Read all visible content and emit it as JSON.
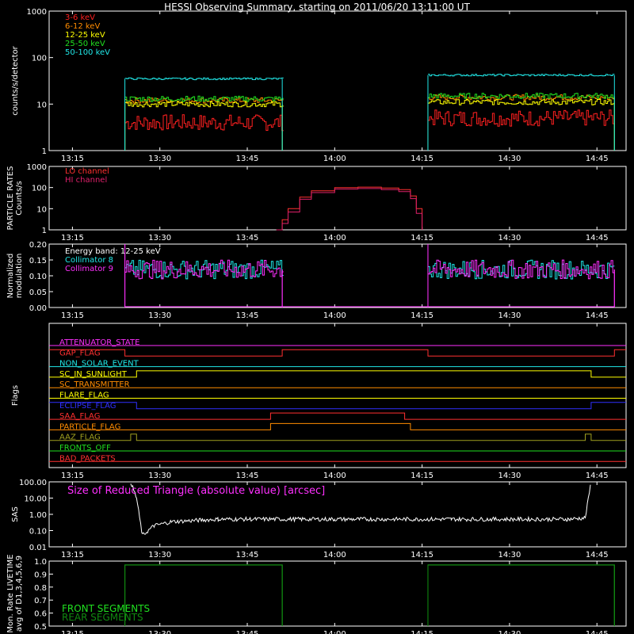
{
  "title": "HESSI Observing Summary, starting on 2011/06/20 13:11:00 UT",
  "time_ticks": [
    "13:15",
    "13:30",
    "13:45",
    "14:00",
    "14:15",
    "14:30",
    "14:45"
  ],
  "chart_data": [
    {
      "type": "line",
      "id": "count_rates",
      "ylabel": "counts/s/detector",
      "yscale": "log",
      "ylim": [
        1,
        1000
      ],
      "yticks": [
        "1",
        "10",
        "100",
        "1000"
      ],
      "x_unit": "UT",
      "series": [
        {
          "name": "3-6 keV",
          "color": "#ff2020",
          "segments": [
            {
              "start": "13:24",
              "end": "13:51",
              "level": 4
            },
            {
              "start": "14:16",
              "end": "14:48",
              "level": 5
            }
          ]
        },
        {
          "name": "6-12 keV",
          "color": "#ff8c00",
          "segments": [
            {
              "start": "13:24",
              "end": "13:51",
              "level": 12
            },
            {
              "start": "14:16",
              "end": "14:48",
              "level": 14
            }
          ]
        },
        {
          "name": "12-25 keV",
          "color": "#ffff00",
          "segments": [
            {
              "start": "13:24",
              "end": "13:51",
              "level": 10
            },
            {
              "start": "14:16",
              "end": "14:48",
              "level": 11
            }
          ]
        },
        {
          "name": "25-50 keV",
          "color": "#20e020",
          "segments": [
            {
              "start": "13:24",
              "end": "13:51",
              "level": 13
            },
            {
              "start": "14:16",
              "end": "14:48",
              "level": 15
            }
          ]
        },
        {
          "name": "50-100 keV",
          "color": "#20e8e8",
          "segments": [
            {
              "start": "13:24",
              "end": "13:51",
              "level": 35
            },
            {
              "start": "14:16",
              "end": "14:48",
              "level": 42
            }
          ]
        }
      ]
    },
    {
      "type": "line",
      "id": "particle_rates",
      "ylabel": "PARTICLE RATES Counts/s",
      "yscale": "log",
      "ylim": [
        1,
        1000
      ],
      "yticks": [
        "1",
        "10",
        "100",
        "1000"
      ],
      "series": [
        {
          "name": "LO channel",
          "color": "#ff3030",
          "points": [
            [
              "13:50",
              1
            ],
            [
              "13:51",
              3
            ],
            [
              "13:52",
              10
            ],
            [
              "13:54",
              35
            ],
            [
              "13:56",
              70
            ],
            [
              "14:00",
              100
            ],
            [
              "14:04",
              105
            ],
            [
              "14:08",
              95
            ],
            [
              "14:11",
              80
            ],
            [
              "14:13",
              40
            ],
            [
              "14:14",
              10
            ],
            [
              "14:15",
              1
            ]
          ]
        },
        {
          "name": "HI channel",
          "color": "#e0206a",
          "points": [
            [
              "13:50",
              1
            ],
            [
              "13:51",
              2
            ],
            [
              "13:52",
              7
            ],
            [
              "13:54",
              28
            ],
            [
              "13:56",
              58
            ],
            [
              "14:00",
              85
            ],
            [
              "14:04",
              90
            ],
            [
              "14:08",
              80
            ],
            [
              "14:11",
              65
            ],
            [
              "14:13",
              30
            ],
            [
              "14:14",
              6
            ],
            [
              "14:15",
              1
            ]
          ]
        }
      ]
    },
    {
      "type": "line",
      "id": "modulation",
      "ylabel": "Normalized modulation",
      "ylim": [
        0,
        0.2
      ],
      "yticks": [
        "0.00",
        "0.05",
        "0.10",
        "0.15",
        "0.20"
      ],
      "annotation": "Energy band: 12-25 keV",
      "series": [
        {
          "name": "Collimator 8",
          "color": "#20e8e8",
          "segments": [
            {
              "start": "13:24",
              "end": "13:51",
              "level": 0.12
            },
            {
              "start": "14:16",
              "end": "14:48",
              "level": 0.12
            }
          ]
        },
        {
          "name": "Collimator 9",
          "color": "#ff30ff",
          "segments": [
            {
              "start": "13:24",
              "end": "13:51",
              "level": 0.12
            },
            {
              "start": "14:16",
              "end": "14:48",
              "level": 0.12
            }
          ]
        }
      ]
    },
    {
      "type": "line",
      "id": "flags",
      "ylabel": "Flags",
      "series": [
        {
          "name": "ATTENUATOR_STATE",
          "color": "#ff30ff",
          "changes": []
        },
        {
          "name": "GAP_FLAG",
          "color": "#ff3030",
          "changes": [
            "13:24",
            "13:51",
            "14:16",
            "14:48"
          ],
          "initial": 1
        },
        {
          "name": "NON_SOLAR_EVENT",
          "color": "#20e8e8",
          "changes": []
        },
        {
          "name": "SC_IN_SUNLIGHT",
          "color": "#ffff00",
          "changes": [
            "13:26",
            "14:44"
          ],
          "initial": 0
        },
        {
          "name": "SC_TRANSMITTER",
          "color": "#ff8c00",
          "changes": []
        },
        {
          "name": "FLARE_FLAG",
          "color": "#ffff00",
          "changes": []
        },
        {
          "name": "ECLIPSE_FLAG",
          "color": "#3030ff",
          "changes": [
            "13:26",
            "14:44"
          ],
          "initial": 1
        },
        {
          "name": "SAA_FLAG",
          "color": "#ff3030",
          "changes": [
            "13:49",
            "14:12"
          ],
          "initial": 0
        },
        {
          "name": "PARTICLE_FLAG",
          "color": "#ff8c00",
          "changes": [
            "13:49",
            "14:13"
          ],
          "initial": 0
        },
        {
          "name": "AAZ_FLAG",
          "color": "#a0a020",
          "changes": [
            "13:25",
            "13:26",
            "14:43",
            "14:44"
          ],
          "initial": 0
        },
        {
          "name": "FRONTS_OFF",
          "color": "#20e020",
          "changes": []
        },
        {
          "name": "BAD_PACKETS",
          "color": "#ff3030",
          "changes": []
        }
      ]
    },
    {
      "type": "line",
      "id": "sas",
      "ylabel": "SAS",
      "yscale": "log",
      "ylim": [
        0.01,
        100
      ],
      "yticks": [
        "0.01",
        "0.10",
        "1.00",
        "10.00",
        "100.00"
      ],
      "annotation": "Size of Reduced Triangle (absolute value) [arcsec]",
      "series": [
        {
          "name": "SAS triangle",
          "color": "#ffffff",
          "points": [
            [
              "13:25",
              100
            ],
            [
              "13:26",
              10
            ],
            [
              "13:27",
              0.05
            ],
            [
              "13:29",
              0.2
            ],
            [
              "13:32",
              0.35
            ],
            [
              "13:40",
              0.5
            ],
            [
              "14:00",
              0.5
            ],
            [
              "14:20",
              0.5
            ],
            [
              "14:40",
              0.5
            ],
            [
              "14:43",
              0.6
            ],
            [
              "14:44",
              100
            ]
          ]
        }
      ]
    },
    {
      "type": "line",
      "id": "livetime",
      "ylabel": "Mon. Rate LIVETIME avg of D1,3,4,5,6,9",
      "ylim": [
        0.5,
        1.0
      ],
      "yticks": [
        "0.5",
        "0.6",
        "0.7",
        "0.8",
        "0.9",
        "1.0"
      ],
      "series": [
        {
          "name": "FRONT SEGMENTS",
          "color": "#20e020",
          "segments": [
            {
              "start": "13:24",
              "end": "13:51",
              "level": 0.97
            },
            {
              "start": "14:16",
              "end": "14:48",
              "level": 0.97
            }
          ]
        },
        {
          "name": "REAR SEGMENTS",
          "color": "#108810",
          "segments": [
            {
              "start": "13:24",
              "end": "13:51",
              "level": 0.97
            },
            {
              "start": "14:16",
              "end": "14:48",
              "level": 0.97
            }
          ]
        }
      ]
    }
  ]
}
